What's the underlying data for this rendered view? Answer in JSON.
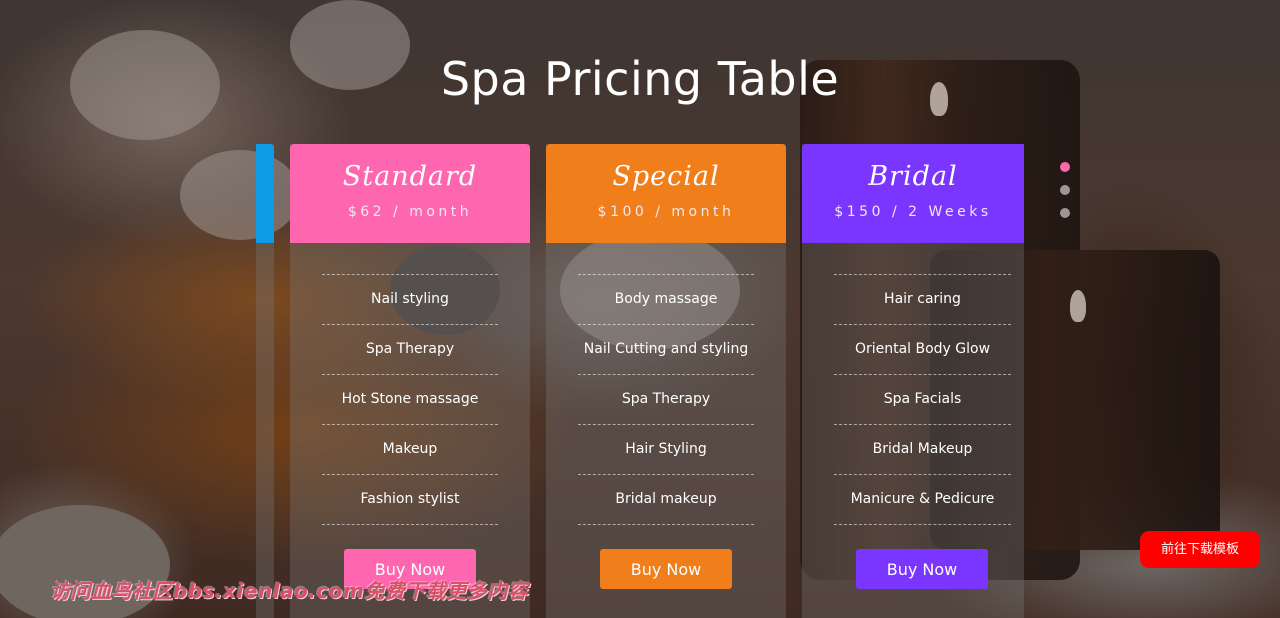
{
  "page": {
    "title": "Spa Pricing Table"
  },
  "plans": [
    {
      "name": "Standard",
      "price": "$62 / month",
      "color": "#ff66b0",
      "features": [
        "Nail styling",
        "Spa Therapy",
        "Hot Stone massage",
        "Makeup",
        "Fashion stylist"
      ],
      "button_label": "Buy Now"
    },
    {
      "name": "Special",
      "price": "$100 / month",
      "color": "#f07e1b",
      "features": [
        "Body massage",
        "Nail Cutting and styling",
        "Spa Therapy",
        "Hair Styling",
        "Bridal makeup"
      ],
      "button_label": "Buy Now"
    },
    {
      "name": "Bridal",
      "price": "$150 / 2 Weeks",
      "color": "#7a35ff",
      "features": [
        "Hair caring",
        "Oriental Body Glow",
        "Spa Facials",
        "Bridal Makeup",
        "Manicure & Pedicure"
      ],
      "button_label": "Buy Now"
    }
  ],
  "peek_card_color": "#0e9be5",
  "pagination": {
    "active_index": 0,
    "count": 3,
    "active_color": "#ff66b0"
  },
  "overlay": {
    "watermark": "访问血鸟社区bbs.xienlao.com免费下载更多内容",
    "download_button": "前往下载模板",
    "download_color": "#ff0000"
  }
}
